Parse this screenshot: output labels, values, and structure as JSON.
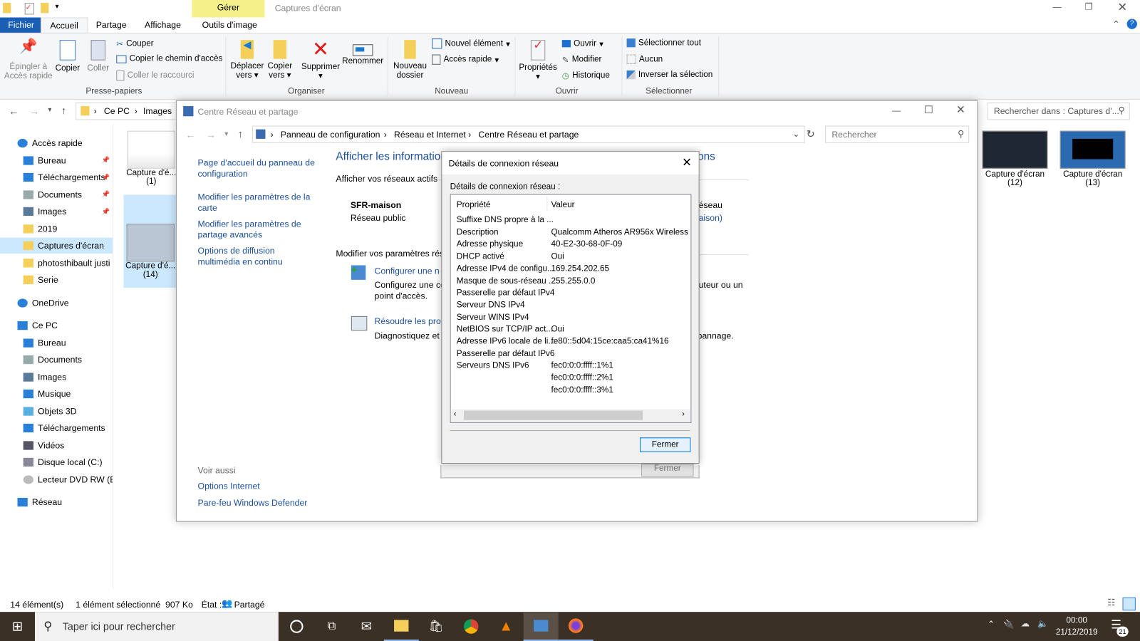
{
  "window": {
    "title": "Captures d'écran",
    "context_tab": "Gérer"
  },
  "ribbon": {
    "tabs": [
      "Fichier",
      "Accueil",
      "Partage",
      "Affichage",
      "Outils d'image"
    ],
    "clipboard": {
      "pin": "Épingler à Accès rapide",
      "copy": "Copier",
      "paste": "Coller",
      "cut": "Couper",
      "copy_path": "Copier le chemin d'accès",
      "paste_shortcut": "Coller le raccourci",
      "group": "Presse-papiers"
    },
    "organize": {
      "move": "Déplacer vers",
      "copyto": "Copier vers",
      "delete": "Supprimer",
      "rename": "Renommer",
      "group": "Organiser"
    },
    "new": {
      "folder": "Nouveau dossier",
      "new_item": "Nouvel élément",
      "quick": "Accès rapide",
      "group": "Nouveau"
    },
    "open": {
      "props": "Propriétés",
      "open": "Ouvrir",
      "edit": "Modifier",
      "history": "Historique",
      "group": "Ouvrir"
    },
    "select": {
      "all": "Sélectionner tout",
      "none": "Aucun",
      "invert": "Inverser la sélection",
      "group": "Sélectionner"
    }
  },
  "address": {
    "crumbs": [
      "Ce PC",
      "Images"
    ],
    "search_placeholder": "Rechercher dans : Captures d'..."
  },
  "sidebar": {
    "items": [
      {
        "label": "Accès rapide",
        "icon": "star-icon",
        "indent": 0
      },
      {
        "label": "Bureau",
        "icon": "desktop-icon",
        "indent": 1,
        "pin": true
      },
      {
        "label": "Téléchargements",
        "icon": "download-icon",
        "indent": 1,
        "pin": true
      },
      {
        "label": "Documents",
        "icon": "document-icon",
        "indent": 1,
        "pin": true
      },
      {
        "label": "Images",
        "icon": "images-icon",
        "indent": 1,
        "pin": true
      },
      {
        "label": "2019",
        "icon": "folder-icon",
        "indent": 1
      },
      {
        "label": "Captures d'écran",
        "icon": "folder-icon",
        "indent": 1,
        "selected": true
      },
      {
        "label": "photosthibault justi",
        "icon": "folder-icon",
        "indent": 1
      },
      {
        "label": "Serie",
        "icon": "folder-icon",
        "indent": 1
      },
      {
        "label": "OneDrive",
        "icon": "cloud-icon",
        "indent": 0,
        "gap": true
      },
      {
        "label": "Ce PC",
        "icon": "computer-icon",
        "indent": 0,
        "gap": true
      },
      {
        "label": "Bureau",
        "icon": "desktop-icon",
        "indent": 1
      },
      {
        "label": "Documents",
        "icon": "document-icon",
        "indent": 1
      },
      {
        "label": "Images",
        "icon": "images-icon",
        "indent": 1
      },
      {
        "label": "Musique",
        "icon": "music-icon",
        "indent": 1
      },
      {
        "label": "Objets 3D",
        "icon": "cube-icon",
        "indent": 1
      },
      {
        "label": "Téléchargements",
        "icon": "download-icon",
        "indent": 1
      },
      {
        "label": "Vidéos",
        "icon": "video-icon",
        "indent": 1
      },
      {
        "label": "Disque local (C:)",
        "icon": "drive-icon",
        "indent": 1
      },
      {
        "label": "Lecteur DVD RW (E:",
        "icon": "dvd-icon",
        "indent": 1
      },
      {
        "label": "Réseau",
        "icon": "network-icon",
        "indent": 0,
        "gap": true
      }
    ]
  },
  "files": [
    {
      "name": "Capture d'é...",
      "num": "(1)"
    },
    {
      "name": "Capture d'é...",
      "num": "(14)"
    },
    {
      "name": "Capture d'écran",
      "num": "(12)"
    },
    {
      "name": "Capture d'écran",
      "num": "(13)"
    }
  ],
  "status": {
    "count": "14 élément(s)",
    "selected": "1 élément sélectionné  907 Ko",
    "state_label": "État :",
    "state": "Partagé"
  },
  "netcenter": {
    "title": "Centre Réseau et partage",
    "crumbs": [
      "Panneau de configuration",
      "Réseau et Internet",
      "Centre Réseau et partage"
    ],
    "search_placeholder": "Rechercher",
    "left_links": [
      "Page d'accueil du panneau de configuration",
      "Modifier les paramètres de la carte",
      "Modifier les paramètres de partage avancés",
      "Options de diffusion multimédia en continu"
    ],
    "see_also": "Voir aussi",
    "see_also_links": [
      "Options Internet",
      "Pare-feu Windows Defender"
    ],
    "heading": "Afficher les informations de base de votre réseau et configurer des connexions",
    "active_label": "Afficher vos réseaux actifs",
    "network_name": "SFR-maison",
    "network_type": "Réseau public",
    "right_partial_1": "éseau",
    "right_partial_2": "aison)",
    "modify_label": "Modifier vos paramètres réseau",
    "setup_link": "Configurer une nouvelle connexion ou un nouveau réseau",
    "setup_desc": "Configurez une connexion haut débit, d'accès à distance ou VPN, ou configurez un routeur ou un point d'accès.",
    "setup_right": "uteur ou un",
    "troubleshoot_link": "Résoudre les problèmes",
    "troubleshoot_desc": "Diagnostiquez et réparez les problèmes de réseau ou obtenez des informations de dépannage.",
    "troubleshoot_right": "pannage.",
    "behind_close": "Fermer"
  },
  "dialog": {
    "title": "Détails de connexion réseau",
    "label": "Détails de connexion réseau :",
    "col_property": "Propriété",
    "col_value": "Valeur",
    "rows": [
      [
        "Suffixe DNS propre à la ...",
        ""
      ],
      [
        "Description",
        "Qualcomm Atheros AR956x Wireless Network Adapter"
      ],
      [
        "Adresse physique",
        "40-E2-30-68-0F-09"
      ],
      [
        "DHCP activé",
        "Oui"
      ],
      [
        "Adresse IPv4 de configu...",
        "169.254.202.65"
      ],
      [
        "Masque de sous-réseau ...",
        "255.255.0.0"
      ],
      [
        "Passerelle par défaut IPv4",
        ""
      ],
      [
        "Serveur DNS IPv4",
        ""
      ],
      [
        "Serveur WINS IPv4",
        ""
      ],
      [
        "NetBIOS sur TCP/IP act...",
        "Oui"
      ],
      [
        "Adresse IPv6 locale de li...",
        "fe80::5d04:15ce:caa5:ca41%16"
      ],
      [
        "Passerelle par défaut IPv6",
        ""
      ],
      [
        "Serveurs DNS IPv6",
        "fec0:0:0:ffff::1%1"
      ],
      [
        "",
        "fec0:0:0:ffff::2%1"
      ],
      [
        "",
        "fec0:0:0:ffff::3%1"
      ]
    ],
    "close": "Fermer"
  },
  "taskbar": {
    "search_placeholder": "Taper ici pour rechercher",
    "time": "00:00",
    "date": "21/12/2019",
    "notif_count": "21",
    "accent": "#0078d7"
  }
}
